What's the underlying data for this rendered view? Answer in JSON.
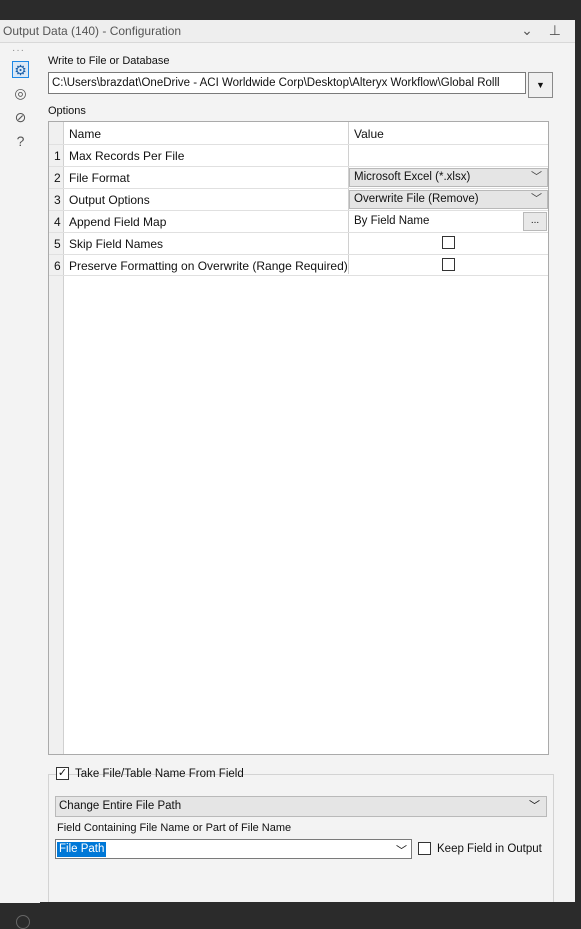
{
  "window": {
    "title": "Output Data (140) - Configuration"
  },
  "write_section": {
    "label": "Write to File or Database",
    "path_value": "C:\\Users\\brazdat\\OneDrive - ACI Worldwide Corp\\Desktop\\Alteryx Workflow\\Global Rolll"
  },
  "options": {
    "label": "Options",
    "columns": [
      "Name",
      "Value"
    ],
    "rows": [
      {
        "num": "1",
        "name": "Max Records Per File",
        "value": ""
      },
      {
        "num": "2",
        "name": "File Format",
        "value": "Microsoft Excel (*.xlsx)"
      },
      {
        "num": "3",
        "name": "Output Options",
        "value": "Overwrite File (Remove)"
      },
      {
        "num": "4",
        "name": "Append Field Map",
        "value": "By Field Name",
        "button": "..."
      },
      {
        "num": "5",
        "name": "Skip Field Names",
        "value": ""
      },
      {
        "num": "6",
        "name": "Preserve Formatting on Overwrite (Range Required)",
        "value": ""
      }
    ]
  },
  "take_name": {
    "label": "Take File/Table Name From Field",
    "checked_mark": "✓",
    "mode_value": "Change Entire File Path",
    "field_label": "Field Containing File Name or Part of File Name",
    "field_value": "File Path",
    "keep_label": "Keep Field in Output"
  },
  "icons": {
    "collapse": "chevron-down-icon",
    "pin": "pin-icon",
    "config": "gear-icon",
    "annotation": "annotation-icon",
    "tag": "tag-icon",
    "help": "help-icon"
  }
}
